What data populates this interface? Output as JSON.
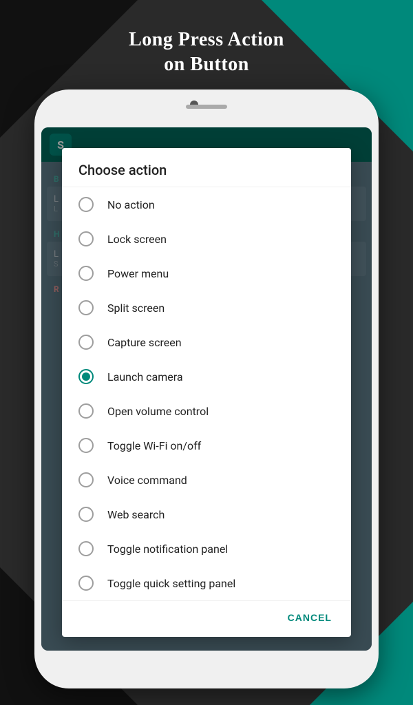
{
  "title": {
    "line1": "Long Press Action",
    "line2": "on Button"
  },
  "dialog": {
    "title": "Choose action",
    "options": [
      {
        "id": "no_action",
        "label": "No action",
        "selected": false
      },
      {
        "id": "lock_screen",
        "label": "Lock screen",
        "selected": false
      },
      {
        "id": "power_menu",
        "label": "Power menu",
        "selected": false
      },
      {
        "id": "split_screen",
        "label": "Split screen",
        "selected": false
      },
      {
        "id": "capture_screen",
        "label": "Capture screen",
        "selected": false
      },
      {
        "id": "launch_camera",
        "label": "Launch camera",
        "selected": true
      },
      {
        "id": "open_volume",
        "label": "Open volume control",
        "selected": false
      },
      {
        "id": "toggle_wifi",
        "label": "Toggle Wi-Fi on/off",
        "selected": false
      },
      {
        "id": "voice_command",
        "label": "Voice command",
        "selected": false
      },
      {
        "id": "web_search",
        "label": "Web search",
        "selected": false
      },
      {
        "id": "toggle_notification",
        "label": "Toggle notification panel",
        "selected": false
      },
      {
        "id": "toggle_quick_setting",
        "label": "Toggle quick setting panel",
        "selected": false
      }
    ],
    "cancel_label": "CANCEL"
  },
  "app_bg": {
    "section_label": "B",
    "items": [
      {
        "label": "L",
        "sub": "L"
      },
      {
        "label": "H",
        "sub": ""
      },
      {
        "label": "L",
        "sub": "S"
      },
      {
        "label": "R",
        "sub": ""
      }
    ]
  },
  "colors": {
    "accent": "#00897b",
    "background": "#2a2a2a",
    "teal": "#00897b"
  }
}
